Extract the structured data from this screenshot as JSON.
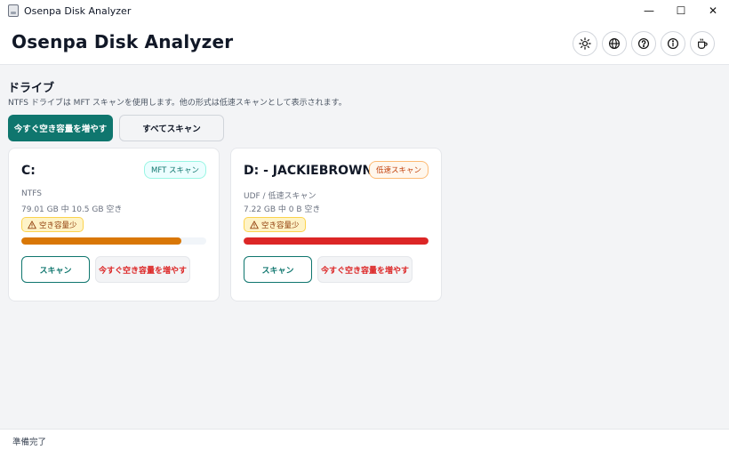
{
  "window": {
    "title": "Osenpa Disk Analyzer",
    "minimize_glyph": "—",
    "maximize_glyph": "☐",
    "close_glyph": "✕"
  },
  "header": {
    "title": "Osenpa Disk Analyzer",
    "icons": [
      "sun-icon",
      "globe-icon",
      "help-icon",
      "info-icon",
      "coffee-icon"
    ]
  },
  "drives_section": {
    "title": "ドライブ",
    "description": "NTFS ドライブは MFT スキャンを使用します。他の形式は低速スキャンとして表示されます。",
    "free_space_now_label": "今すぐ空き容量を増やす",
    "scan_all_label": "すべてスキャン"
  },
  "drives": [
    {
      "name": "C:",
      "scan_type": "MFT スキャン",
      "filesystem": "NTFS",
      "space": "79.01 GB 中 10.5 GB 空き",
      "warning": "空き容量少",
      "used_fraction": 0.867,
      "scan_label": "スキャン",
      "free_label": "今すぐ空き容量を増やす"
    },
    {
      "name": "D: - JACKIEBROWN",
      "scan_type": "低速スキャン",
      "filesystem": "UDF / 低速スキャン",
      "space": "7.22 GB 中 0 B 空き",
      "warning": "空き容量少",
      "used_fraction": 1.0,
      "scan_label": "スキャン",
      "free_label": "今すぐ空き容量を増やす"
    }
  ],
  "status": {
    "text": "準備完了"
  },
  "colors": {
    "accent": "#0f766e",
    "warning": "#d97706",
    "danger": "#dc2626"
  }
}
